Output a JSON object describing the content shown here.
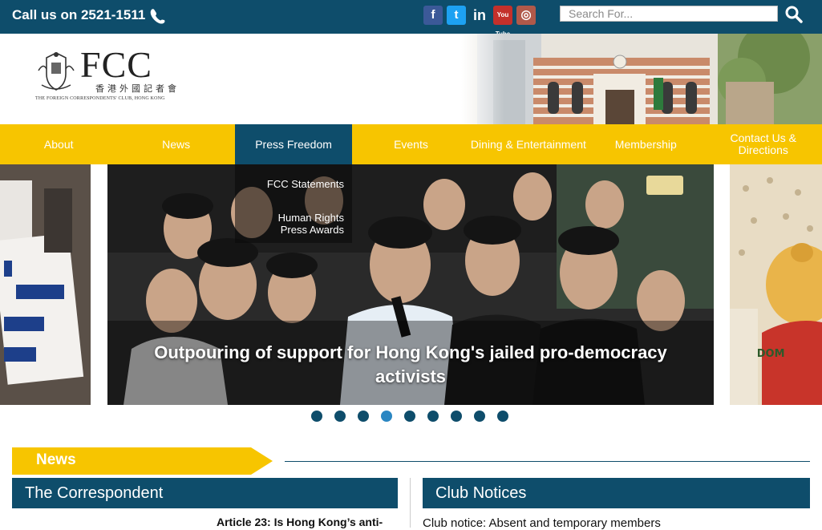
{
  "topbar": {
    "call_text": "Call us on 2521-1511",
    "phone_icon": "phone-icon",
    "social": [
      {
        "name": "facebook-icon",
        "glyph": "f"
      },
      {
        "name": "twitter-icon",
        "glyph": "t"
      },
      {
        "name": "linkedin-icon",
        "glyph": "in"
      },
      {
        "name": "youtube-icon",
        "glyph": "You Tube"
      },
      {
        "name": "instagram-icon",
        "glyph": "◎"
      }
    ],
    "search_placeholder": "Search For...",
    "search_icon": "search-icon"
  },
  "header": {
    "logo_text": "FCC",
    "logo_cn": "香港外國記者會",
    "logo_sub": "THE FOREIGN CORRESPONDENTS' CLUB, HONG KONG"
  },
  "nav": {
    "items": [
      {
        "label": "About"
      },
      {
        "label": "News"
      },
      {
        "label": "Press Freedom",
        "active": true
      },
      {
        "label": "Events"
      },
      {
        "label": "Dining & Entertainment"
      },
      {
        "label": "Membership"
      },
      {
        "label": "Contact Us & Directions"
      }
    ],
    "dropdown": [
      {
        "label": "FCC Statements"
      },
      {
        "label": "Human Rights Press Awards"
      }
    ]
  },
  "slider": {
    "caption": "Outpouring of support for Hong Kong's jailed pro-democracy activists",
    "dot_count": 9,
    "active_dot": 4
  },
  "news": {
    "section_label": "News",
    "left_panel_title": "The Correspondent",
    "right_panel_title": "Club Notices",
    "article_title": "Article 23: Is Hong Kong’s anti-",
    "notice_text": "Club notice: Absent and temporary members"
  },
  "colors": {
    "navy": "#0e4d6b",
    "yellow": "#f7c500",
    "active_dot": "#2a86c2"
  }
}
